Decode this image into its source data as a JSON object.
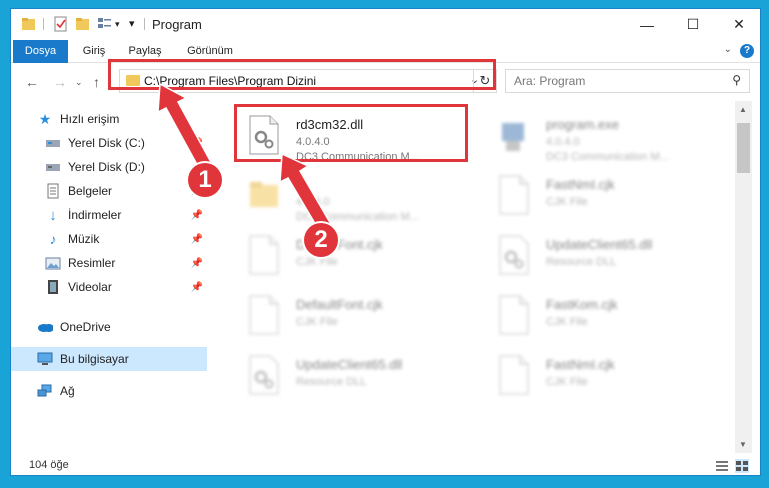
{
  "window": {
    "title": "Program",
    "minimize": "—",
    "maximize": "☐",
    "close": "✕"
  },
  "ribbon": {
    "tabs": [
      "Dosya",
      "Giriş",
      "Paylaş",
      "Görünüm"
    ],
    "help": "?"
  },
  "nav": {
    "address_path": "C:\\Program Files\\Program Dizini",
    "search_placeholder": "Ara: Program"
  },
  "sidebar": {
    "items": [
      {
        "label": "Hızlı erişim",
        "icon": "star-icon"
      },
      {
        "label": "Yerel Disk (C:)",
        "icon": "drive-icon"
      },
      {
        "label": "Yerel Disk (D:)",
        "icon": "drive-icon"
      },
      {
        "label": "Belgeler",
        "icon": "document-icon"
      },
      {
        "label": "İndirmeler",
        "icon": "download-icon"
      },
      {
        "label": "Müzik",
        "icon": "music-icon"
      },
      {
        "label": "Resimler",
        "icon": "pictures-icon"
      },
      {
        "label": "Videolar",
        "icon": "video-icon"
      },
      {
        "label": "OneDrive",
        "icon": "cloud-icon"
      },
      {
        "label": "Bu bilgisayar",
        "icon": "computer-icon"
      },
      {
        "label": "Ağ",
        "icon": "network-icon"
      }
    ]
  },
  "files": [
    {
      "name": "rd3cm32.dll",
      "sub1": "4.0.4.0",
      "sub2": "DC3 Communication M..."
    },
    {
      "name": "program.exe",
      "sub1": "4.0.4.0",
      "sub2": "DC3 Communication M..."
    },
    {
      "name": "",
      "sub1": "4.0.4.0",
      "sub2": "DC3 Communication M..."
    },
    {
      "name": "FastNmI.cjk",
      "sub1": "CJK File",
      "sub2": ""
    },
    {
      "name": "DefaultFont.cjk",
      "sub1": "CJK File",
      "sub2": ""
    },
    {
      "name": "UpdateClient65.dll",
      "sub1": "Resource DLL",
      "sub2": ""
    },
    {
      "name": "DefaultFont.cjk",
      "sub1": "CJK File",
      "sub2": ""
    },
    {
      "name": "FastKom.cjk",
      "sub1": "CJK File",
      "sub2": ""
    },
    {
      "name": "UpdateClient65.dll",
      "sub1": "Resource DLL",
      "sub2": ""
    },
    {
      "name": "FastNmI.cjk",
      "sub1": "CJK File",
      "sub2": ""
    }
  ],
  "status": {
    "count": "104 öğe"
  },
  "annotations": {
    "badge1": "1",
    "badge2": "2",
    "color": "#e0353b"
  }
}
